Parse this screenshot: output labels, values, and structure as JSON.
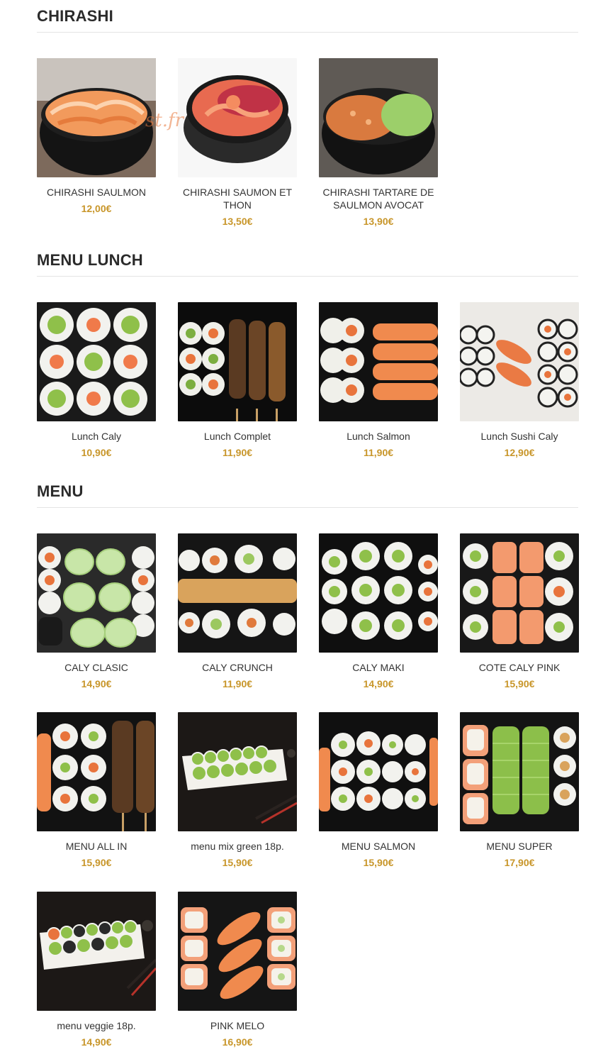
{
  "sections": [
    {
      "title": "CHIRASHI",
      "items": [
        {
          "name": "CHIRASHI SAULMON",
          "price": "12,00€"
        },
        {
          "name": "CHIRASHI SAUMON ET THON",
          "price": "13,50€"
        },
        {
          "name": "CHIRASHI TARTARE DE SAULMON AVOCAT",
          "price": "13,90€"
        }
      ]
    },
    {
      "title": "MENU LUNCH",
      "items": [
        {
          "name": "Lunch Caly",
          "price": "10,90€"
        },
        {
          "name": "Lunch Complet",
          "price": "11,90€"
        },
        {
          "name": "Lunch Salmon",
          "price": "11,90€"
        },
        {
          "name": "Lunch Sushi Caly",
          "price": "12,90€"
        }
      ]
    },
    {
      "title": "MENU",
      "items": [
        {
          "name": "CALY CLASIC",
          "price": "14,90€"
        },
        {
          "name": "CALY CRUNCH",
          "price": "11,90€"
        },
        {
          "name": "CALY MAKI",
          "price": "14,90€"
        },
        {
          "name": "COTE CALY PINK",
          "price": "15,90€"
        },
        {
          "name": "MENU ALL IN",
          "price": "15,90€"
        },
        {
          "name": "menu mix green 18p.",
          "price": "15,90€"
        },
        {
          "name": "MENU SALMON",
          "price": "15,90€"
        },
        {
          "name": "MENU SUPER",
          "price": "17,90€"
        },
        {
          "name": "menu veggie 18p.",
          "price": "14,90€"
        },
        {
          "name": "PINK MELO",
          "price": "16,90€"
        }
      ]
    }
  ],
  "watermark": "st.fr",
  "colors": {
    "price": "#c8962a",
    "title": "#2b2b2b",
    "rule": "#e4e4e4"
  }
}
